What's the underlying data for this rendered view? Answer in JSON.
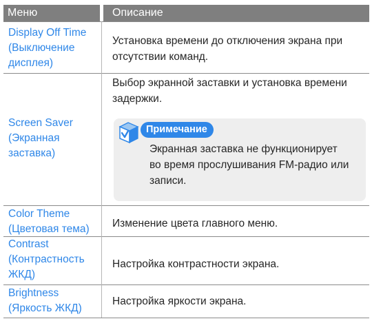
{
  "header": {
    "menu": "Меню",
    "description": "Описание"
  },
  "rows": [
    {
      "menu": [
        "Display Off Time",
        "(Выключение",
        "дисплея)"
      ],
      "description": [
        "Установка времени до отключения экрана при",
        "отсутствии команд."
      ]
    },
    {
      "menu": [
        "Screen Saver",
        "(Экранная",
        "заставка)"
      ],
      "description": [
        "Выбор экранной заставки и установка времени",
        "задержки."
      ],
      "note": {
        "icon": "note-checkbox-icon",
        "label": "Примечание",
        "lines": [
          "Экранная заставка не функционирует",
          "во время прослушивания FM-радио или",
          "записи."
        ]
      }
    },
    {
      "menu": [
        "Color Theme",
        "(Цветовая тема)"
      ],
      "description": [
        "Изменение цвета главного меню."
      ]
    },
    {
      "menu": [
        "Contrast",
        "(Контрастность",
        "ЖКД)"
      ],
      "description": [
        "Настройка контрастности экрана."
      ]
    },
    {
      "menu": [
        "Brightness",
        "(Яркость ЖКД)"
      ],
      "description": [
        "Настройка яркости экрана."
      ]
    }
  ],
  "colors": {
    "header_bg": "#7f7f7f",
    "menu_text": "#2f87e8",
    "note_bg": "#eeeeee",
    "note_accent": "#2f87e8"
  }
}
